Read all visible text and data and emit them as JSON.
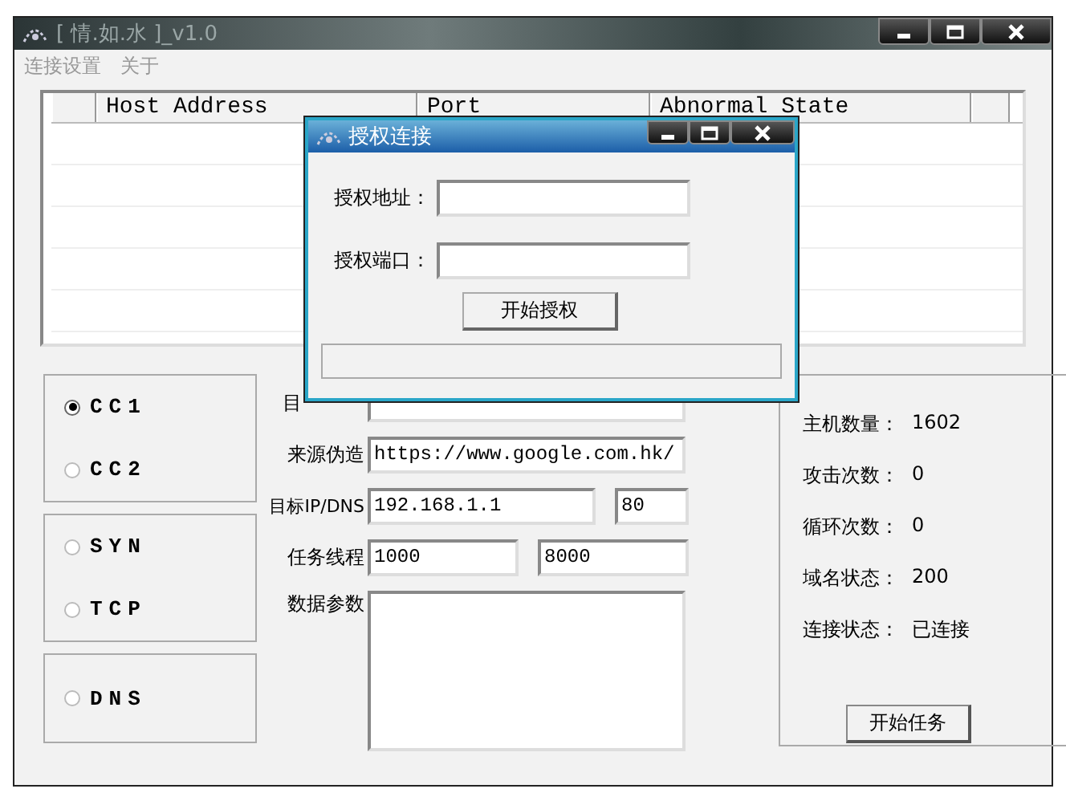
{
  "window": {
    "title": "[ 情.如.水 ]_v1.0",
    "menu": [
      "连接设置",
      "关于"
    ]
  },
  "table": {
    "columns": [
      "Host Address",
      "Port",
      "Abnormal State"
    ]
  },
  "modes": [
    [
      {
        "label": "CC1",
        "selected": true
      },
      {
        "label": "CC2",
        "selected": false
      }
    ],
    [
      {
        "label": "SYN",
        "selected": false
      },
      {
        "label": "TCP",
        "selected": false
      }
    ],
    [
      {
        "label": "DNS",
        "selected": false
      }
    ]
  ],
  "form": {
    "target_label": "目",
    "referer": {
      "label": "来源伪造",
      "value": "https://www.google.com.hk/"
    },
    "target": {
      "label": "目标IP/DNS",
      "value": "192.168.1.1",
      "port": "80"
    },
    "threads": {
      "label": "任务线程",
      "value": "1000",
      "value_2": "8000"
    },
    "params": {
      "label": "数据参数"
    }
  },
  "stats": [
    {
      "label": "主机数量：",
      "value": "1602"
    },
    {
      "label": "攻击次数：",
      "value": "0"
    },
    {
      "label": "循环次数：",
      "value": "0"
    },
    {
      "label": "域名状态：",
      "value": "200"
    },
    {
      "label": "连接状态：",
      "value": "已连接"
    }
  ],
  "start_button": "开始任务",
  "dialog": {
    "title": "授权连接",
    "fields": [
      {
        "label": "授权地址："
      },
      {
        "label": "授权端口："
      }
    ],
    "button": "开始授权"
  }
}
